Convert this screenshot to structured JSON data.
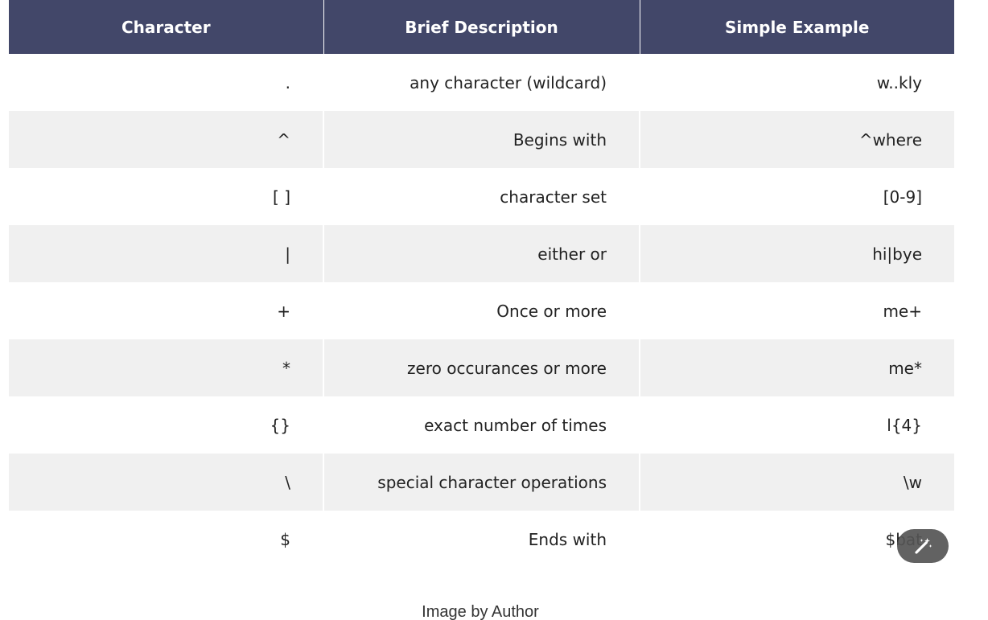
{
  "table": {
    "headers": [
      "Character",
      "Brief Description",
      "Simple Example"
    ],
    "rows": [
      [
        ".",
        "any character (wildcard)",
        "w..kly"
      ],
      [
        "^",
        "Begins with",
        "^where"
      ],
      [
        "[ ]",
        "character set",
        "[0-9]"
      ],
      [
        "|",
        "either or",
        "hi|bye"
      ],
      [
        "+",
        "Once or more",
        "me+"
      ],
      [
        "*",
        "zero occurances or more",
        "me*"
      ],
      [
        "{}",
        "exact number of times",
        "l{4}"
      ],
      [
        "\\",
        "special character operations",
        "\\w"
      ],
      [
        "$",
        "Ends with",
        "$bat"
      ]
    ]
  },
  "caption": "Image by Author",
  "fab": {
    "icon": "magic-wand-edit-icon"
  },
  "colors": {
    "header_bg": "#424769",
    "stripe_bg": "#f0f0f0"
  }
}
